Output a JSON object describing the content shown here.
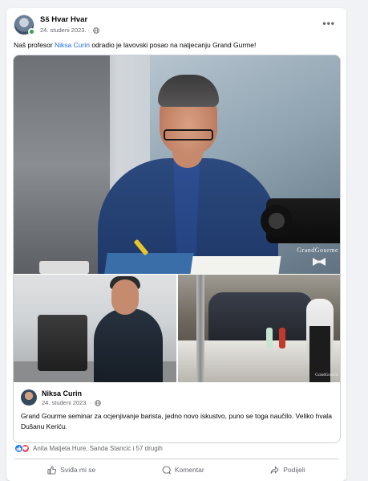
{
  "post": {
    "author": "Sš Hvar Hvar",
    "date": "24. studeni 2023.",
    "meta_separator": "·",
    "text_before": "Naš profesor ",
    "mention": "Niksa Curin",
    "text_after": " odradio je lavovski posao na natjecanju Grand Gurme!"
  },
  "photos": {
    "main_watermark": "GrandGourme",
    "right_watermark": "GrandGourme"
  },
  "shared": {
    "author": "Niksa Curin",
    "date": "24. studeni 2023.",
    "meta_separator": "·",
    "text": "Grand Gourme seminar za ocjenjivanje barista, jedno novo iskustvo, puno se toga naučilo. Veliko hvala Dušanu Keriću."
  },
  "reactions": {
    "summary": "Anita Matjeta Hure, Sanda Stancic i 57 drugih",
    "types": [
      "like-icon",
      "love-icon"
    ]
  },
  "actions": {
    "like": "Sviđa mi se",
    "comment": "Komentar",
    "share": "Podijeli"
  },
  "colors": {
    "accent": "#216fdb",
    "like": "#1877f2",
    "love": "#f33e58",
    "online": "#31a24c"
  }
}
